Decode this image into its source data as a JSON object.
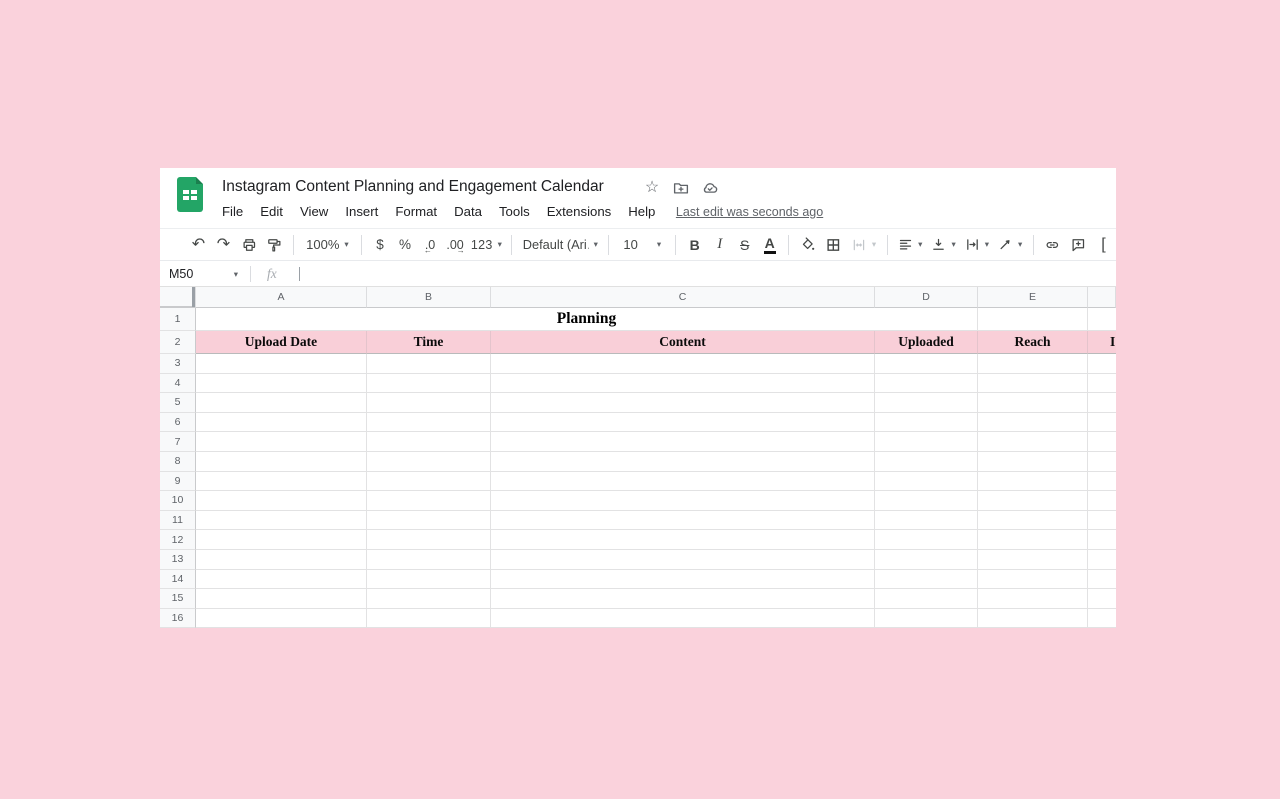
{
  "app": {
    "title": "Instagram Content Planning and Engagement Calendar"
  },
  "menu": {
    "items": [
      "File",
      "Edit",
      "View",
      "Insert",
      "Format",
      "Data",
      "Tools",
      "Extensions",
      "Help"
    ],
    "last_edit": "Last edit was seconds ago"
  },
  "toolbar": {
    "zoom": "100%",
    "currency": "$",
    "percent": "%",
    "decimal_decrease": ".0",
    "decimal_increase": ".00",
    "more_formats": "123",
    "font_family": "Default (Ari…",
    "font_size": "10",
    "bold": "B",
    "italic": "I",
    "strikethrough": "S",
    "text_color": "A"
  },
  "formula_bar": {
    "cell_reference": "M50",
    "fx_label": "fx"
  },
  "sheet": {
    "column_letters": [
      "A",
      "B",
      "C",
      "D",
      "E"
    ],
    "row_numbers": [
      "1",
      "2"
    ],
    "empty_row_numbers": [
      "3",
      "4",
      "5",
      "6",
      "7",
      "8",
      "9",
      "10",
      "11",
      "12",
      "13",
      "14",
      "15",
      "16"
    ],
    "section_title": "Planning",
    "header_row": [
      "Upload Date",
      "Time",
      "Content",
      "Uploaded",
      "Reach"
    ],
    "partial_header": "I"
  },
  "icons": {
    "undo": "↶",
    "redo": "↷",
    "dropdown": "▾",
    "star": "☆",
    "arrow_left": "←",
    "arrow_right": "→",
    "chart_partial": "["
  },
  "colors": {
    "page_background": "#fad2dc",
    "header_row_fill": "#f9cfd8",
    "logo_green": "#23a566",
    "toolbar_icon": "#444746"
  }
}
